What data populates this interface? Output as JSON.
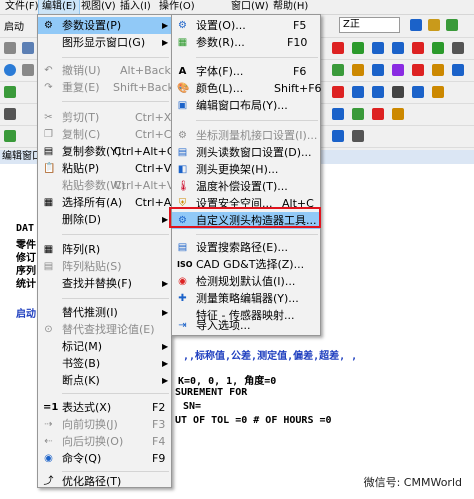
{
  "menubar": {
    "items": [
      "文件(F)",
      "编辑(E)",
      "视图(V)",
      "插入(I)",
      "操作(O)",
      "窗口(W)",
      "帮助(H)"
    ]
  },
  "app": {
    "left_label": "启动",
    "editor_title": "编辑窗口 - ",
    "combo_value": "Z正"
  },
  "code": {
    "lines_left": [
      "DAT",
      "零件",
      "修订",
      "序列",
      "统计"
    ],
    "launch": "启动",
    "line1": ",,标称值,公差,测定值,偏差,超差, ,",
    "line2": "K=0, 0, 1, 角度=0",
    "line3": "SUREMENT FOR",
    "line4": "SN=",
    "line5": "UT OF TOL =0    # OF HOURS =0"
  },
  "edit_menu": {
    "items": [
      {
        "label": "参数设置(P)",
        "has_sub": true
      },
      {
        "label": "图形显示窗口(G)",
        "has_sub": true
      },
      {
        "label": "撤销(U)",
        "shortcut": "Alt+Back"
      },
      {
        "label": "重复(E)",
        "shortcut": "Shift+Back"
      },
      {
        "label": "剪切(T)",
        "shortcut": "Ctrl+X"
      },
      {
        "label": "复制(C)",
        "shortcut": "Ctrl+C"
      },
      {
        "label": "复制参数(Y)",
        "shortcut": "Ctrl+Alt+C"
      },
      {
        "label": "粘贴(P)",
        "shortcut": "Ctrl+V"
      },
      {
        "label": "粘贴参数(W)",
        "shortcut": "Ctrl+Alt+V"
      },
      {
        "label": "选择所有(A)",
        "shortcut": "Ctrl+A"
      },
      {
        "label": "删除(D)",
        "has_sub": true
      },
      {
        "label": "阵列(R)"
      },
      {
        "label": "阵列粘贴(S)"
      },
      {
        "label": "查找并替换(F)",
        "has_sub": true
      },
      {
        "label": "替代推测(I)",
        "has_sub": true
      },
      {
        "label": "替代查找理论值(E)"
      },
      {
        "label": "标记(M)",
        "has_sub": true
      },
      {
        "label": "书签(B)",
        "has_sub": true
      },
      {
        "label": "断点(K)",
        "has_sub": true
      },
      {
        "label": "表达式(X)",
        "shortcut": "F2"
      },
      {
        "label": "向前切换(J)",
        "shortcut": "F3"
      },
      {
        "label": "向后切换(O)",
        "shortcut": "F4"
      },
      {
        "label": "命令(Q)",
        "shortcut": "F9"
      },
      {
        "label": "优化路径(T)"
      }
    ]
  },
  "sub_menu": {
    "items": [
      {
        "label": "设置(O)...",
        "shortcut": "F5"
      },
      {
        "label": "参数(R)...",
        "shortcut": "F10"
      },
      {
        "label": "字体(F)...",
        "shortcut": "F6"
      },
      {
        "label": "颜色(L)...",
        "shortcut": "Shift+F6"
      },
      {
        "label": "编辑窗口布局(Y)..."
      },
      {
        "label": "坐标测量机接口设置(I)..."
      },
      {
        "label": "测头读数窗口设置(D)..."
      },
      {
        "label": "测头更换架(H)..."
      },
      {
        "label": "温度补偿设置(T)..."
      },
      {
        "label": "设置安全空间...",
        "shortcut": "Alt+C"
      },
      {
        "label": "自定义测头构造器工具..."
      },
      {
        "label": "设置搜索路径(E)..."
      },
      {
        "label": "CAD GD&T选择(Z)..."
      },
      {
        "label": "检测规划默认值(I)..."
      },
      {
        "label": "测量策略编辑器(Y)..."
      },
      {
        "label": "特征 - 传感器映射..."
      },
      {
        "label": "导入选项..."
      }
    ]
  },
  "watermark": "微信号: CMMWorld"
}
